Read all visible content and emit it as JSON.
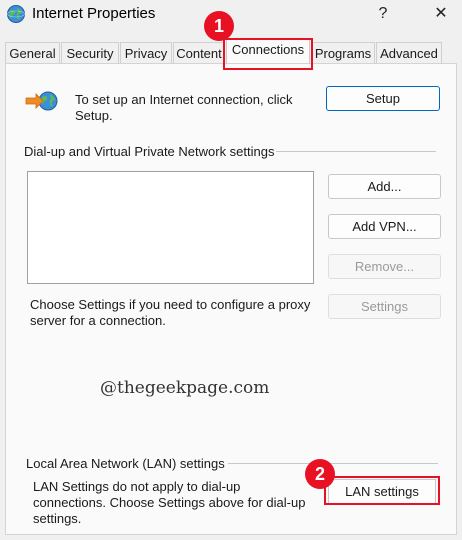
{
  "window": {
    "title": "Internet Properties",
    "help_glyph": "?",
    "close_glyph": "✕"
  },
  "tabs": [
    {
      "label": "General"
    },
    {
      "label": "Security"
    },
    {
      "label": "Privacy"
    },
    {
      "label": "Content"
    },
    {
      "label": "Connections",
      "active": true
    },
    {
      "label": "Programs"
    },
    {
      "label": "Advanced"
    }
  ],
  "setup": {
    "text": "To set up an Internet connection, click Setup.",
    "button": "Setup"
  },
  "dialup": {
    "section_title": "Dial-up and Virtual Private Network settings",
    "list_items": [],
    "add_button": "Add...",
    "add_vpn_button": "Add VPN...",
    "remove_button": "Remove...",
    "settings_button": "Settings",
    "proxy_text": "Choose Settings if you need to configure a proxy server for a connection."
  },
  "watermark": "@thegeekpage.com",
  "lan": {
    "section_title": "Local Area Network (LAN) settings",
    "text": "LAN Settings do not apply to dial-up connections. Choose Settings above for dial-up settings.",
    "button": "LAN settings"
  },
  "annotations": {
    "badge_1": "1",
    "badge_2": "2",
    "color": "#e81123"
  },
  "colors": {
    "accent": "#0067c0",
    "highlight": "#e81123"
  }
}
